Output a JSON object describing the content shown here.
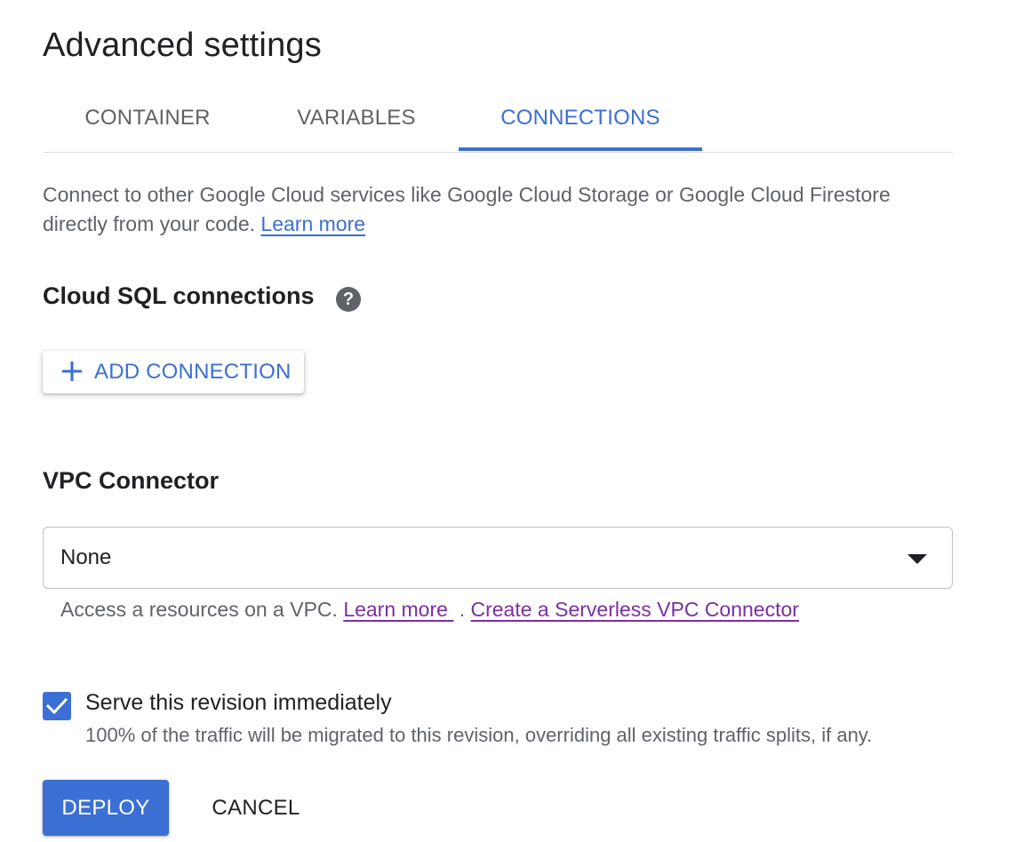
{
  "panel": {
    "title": "Advanced settings"
  },
  "tabs": [
    {
      "label": "CONTAINER",
      "active": false
    },
    {
      "label": "VARIABLES",
      "active": false
    },
    {
      "label": "CONNECTIONS",
      "active": true
    }
  ],
  "intro": {
    "text": "Connect to other Google Cloud services like Google Cloud Storage or Google Cloud Firestore directly from your code.",
    "link_label": "Learn more"
  },
  "cloud_sql": {
    "heading": "Cloud SQL connections",
    "help_icon": "help-circle-icon",
    "add_button_label": "ADD CONNECTION",
    "add_icon": "plus-icon"
  },
  "vpc": {
    "heading": "VPC Connector",
    "selected_value": "None",
    "helper_text": "Access a resources on a VPC.",
    "learn_more_label": "Learn more",
    "separator": ".",
    "create_link_label": "Create a Serverless VPC Connector"
  },
  "serve": {
    "checked": true,
    "label": "Serve this revision immediately",
    "sublabel": "100% of the traffic will be migrated to this revision, overriding all existing traffic splits, if any."
  },
  "actions": {
    "deploy_label": "DEPLOY",
    "cancel_label": "CANCEL"
  },
  "colors": {
    "accent": "#3b6fd3",
    "visited_link": "#7b2fa3",
    "text_primary": "#202124",
    "text_secondary": "#5f6368"
  }
}
